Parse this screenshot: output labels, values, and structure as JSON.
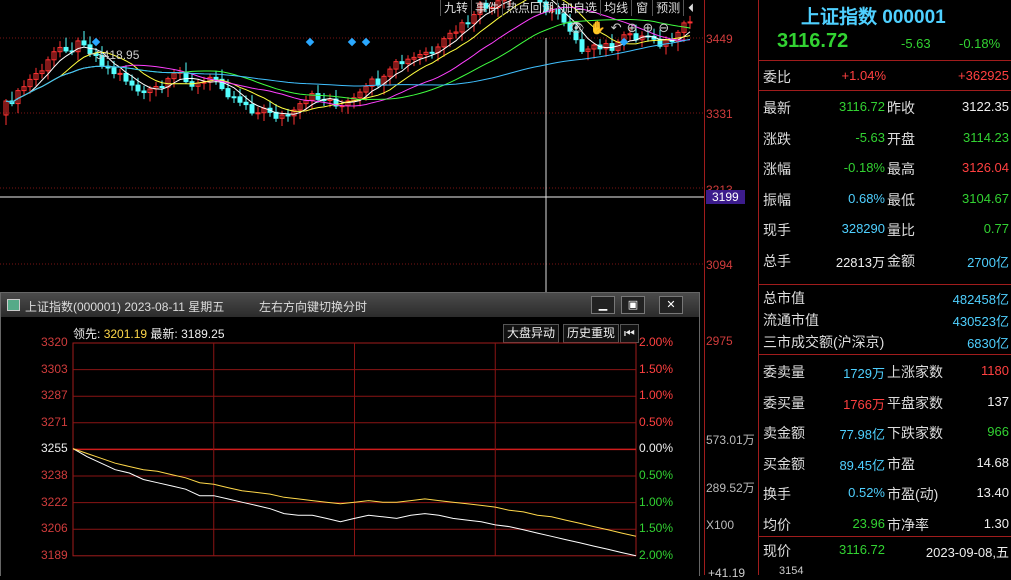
{
  "toolbar": {
    "items": [
      "九转",
      "事件",
      "热点回溯",
      "加自选",
      "均线",
      "窗",
      "预测"
    ],
    "back": "⏴"
  },
  "kline": {
    "high_marker": "3418.95",
    "price_axis": [
      "3449",
      "3331",
      "3213",
      "3199",
      "3094",
      "2975"
    ],
    "volume_axis": [
      "573.01万",
      "289.52万",
      "X100"
    ],
    "bottom_label": "+41.19",
    "bottom_label2": "3154"
  },
  "panel": {
    "title": "上证指数",
    "code": "000001",
    "price": "3116.72",
    "change": "-5.63",
    "pct": "-0.18%",
    "webi": {
      "label": "委比",
      "value": "+1.04%",
      "diff": "+362925"
    },
    "rows": [
      {
        "l1": "最新",
        "v1": "3116.72",
        "c1": "green",
        "l2": "昨收",
        "v2": "3122.35",
        "c2": "white"
      },
      {
        "l1": "涨跌",
        "v1": "-5.63",
        "c1": "green",
        "l2": "开盘",
        "v2": "3114.23",
        "c2": "green"
      },
      {
        "l1": "涨幅",
        "v1": "-0.18%",
        "c1": "green",
        "l2": "最高",
        "v2": "3126.04",
        "c2": "red"
      },
      {
        "l1": "振幅",
        "v1": "0.68%",
        "c1": "cyan",
        "l2": "最低",
        "v2": "3104.67",
        "c2": "green"
      },
      {
        "l1": "现手",
        "v1": "328290",
        "c1": "cyan",
        "l2": "量比",
        "v2": "0.77",
        "c2": "green"
      },
      {
        "l1": "总手",
        "v1": "22813万",
        "c1": "white",
        "l2": "金额",
        "v2": "2700亿",
        "c2": "cyan"
      }
    ],
    "mcap": [
      {
        "l": "总市值",
        "v": "482458亿"
      },
      {
        "l": "流通市值",
        "v": "430523亿"
      },
      {
        "l": "三市成交额(沪深京)",
        "v": "6830亿"
      }
    ],
    "rows2": [
      {
        "l1": "委卖量",
        "v1": "1729万",
        "c1": "cyan",
        "l2": "上涨家数",
        "v2": "1180",
        "c2": "red"
      },
      {
        "l1": "委买量",
        "v1": "1766万",
        "c1": "red",
        "l2": "平盘家数",
        "v2": "137",
        "c2": "white"
      },
      {
        "l1": "卖金额",
        "v1": "77.98亿",
        "c1": "cyan",
        "l2": "下跌家数",
        "v2": "966",
        "c2": "green"
      },
      {
        "l1": "买金额",
        "v1": "89.45亿",
        "c1": "cyan",
        "l2": "市盈",
        "v2": "14.68",
        "c2": "white"
      },
      {
        "l1": "换手",
        "v1": "0.52%",
        "c1": "cyan",
        "l2": "市盈(动)",
        "v2": "13.40",
        "c2": "white"
      },
      {
        "l1": "均价",
        "v1": "23.96",
        "c1": "green",
        "l2": "市净率",
        "v2": "1.30",
        "c2": "white"
      }
    ],
    "now_label": "现价",
    "now_value": "3116.72",
    "now_date": "2023-09-08,五"
  },
  "popup": {
    "title": "上证指数(000001) 2023-08-11 星期五",
    "hint": "左右方向键切换分时",
    "lead_label": "领先:",
    "lead_value": "3201.19",
    "latest_label": "最新:",
    "latest_value": "3189.25",
    "btn_market": "大盘异动",
    "btn_history": "历史重现",
    "left_axis": [
      "3320",
      "3303",
      "3287",
      "3271",
      "3255",
      "3238",
      "3222",
      "3206",
      "3189"
    ],
    "right_axis": [
      "2.00%",
      "1.50%",
      "1.00%",
      "0.50%",
      "0.00%",
      "0.50%",
      "1.00%",
      "1.50%",
      "2.00%"
    ]
  },
  "chart_data": {
    "type": "line",
    "title": "上证指数(000001) 2023-08-11 星期五",
    "ylim": [
      3189,
      3320
    ],
    "series": [
      {
        "name": "最新",
        "values": [
          3255,
          3250,
          3246,
          3242,
          3240,
          3236,
          3234,
          3232,
          3230,
          3226,
          3226,
          3224,
          3222,
          3220,
          3218,
          3215,
          3214,
          3214,
          3212,
          3210,
          3212,
          3214,
          3213,
          3212,
          3214,
          3215,
          3214,
          3212,
          3211,
          3210,
          3208,
          3207,
          3205,
          3203,
          3201,
          3199,
          3197,
          3195,
          3193,
          3191,
          3189
        ]
      },
      {
        "name": "领先",
        "values": [
          3255,
          3252,
          3249,
          3246,
          3244,
          3242,
          3241,
          3239,
          3237,
          3234,
          3233,
          3231,
          3229,
          3228,
          3227,
          3225,
          3224,
          3223,
          3222,
          3221,
          3222,
          3223,
          3222,
          3222,
          3223,
          3224,
          3223,
          3222,
          3221,
          3220,
          3219,
          3217,
          3216,
          3214,
          3213,
          3211,
          3209,
          3207,
          3205,
          3203,
          3201
        ]
      }
    ]
  }
}
